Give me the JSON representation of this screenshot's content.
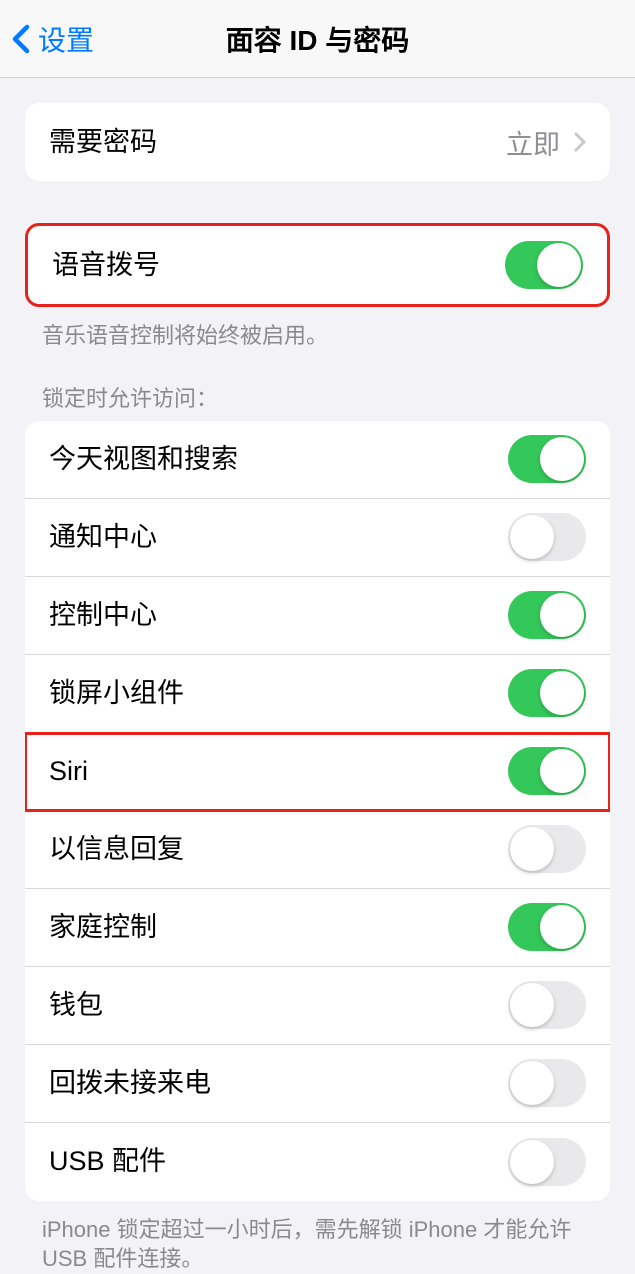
{
  "nav": {
    "back_label": "设置",
    "title": "面容 ID 与密码"
  },
  "require_passcode": {
    "label": "需要密码",
    "value": "立即"
  },
  "voice_dial": {
    "label": "语音拨号",
    "on": true,
    "footer": "音乐语音控制将始终被启用。"
  },
  "lock_access": {
    "header": "锁定时允许访问：",
    "items": [
      {
        "label": "今天视图和搜索",
        "on": true
      },
      {
        "label": "通知中心",
        "on": false
      },
      {
        "label": "控制中心",
        "on": true
      },
      {
        "label": "锁屏小组件",
        "on": true
      },
      {
        "label": "Siri",
        "on": true
      },
      {
        "label": "以信息回复",
        "on": false
      },
      {
        "label": "家庭控制",
        "on": true
      },
      {
        "label": "钱包",
        "on": false
      },
      {
        "label": "回拨未接来电",
        "on": false
      },
      {
        "label": "USB 配件",
        "on": false
      }
    ],
    "footer": "iPhone 锁定超过一小时后，需先解锁 iPhone 才能允许 USB 配件连接。"
  }
}
